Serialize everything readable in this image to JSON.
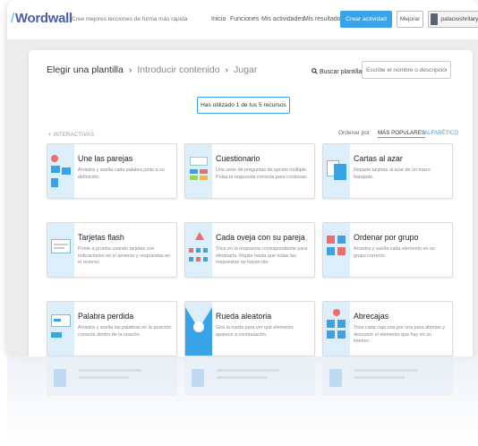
{
  "header": {
    "logo": "Wordwall",
    "tagline": "Cree mejores lecciones de forma más rápida",
    "nav": [
      "Inicio",
      "Funciones",
      "Mis actividades",
      "Mis resultados"
    ],
    "create_button": "Crear actividad",
    "upgrade_button": "Mejorar",
    "username": "palacioshrilary"
  },
  "breadcrumb": {
    "step1": "Elegir una plantilla",
    "step2": "Introducir contenido",
    "step3": "Jugar",
    "separator": "›"
  },
  "search": {
    "label": "Buscar plantillas",
    "placeholder": "Escribe el nombre o descripción..."
  },
  "usage_text": "Has utilizado 1 de tus 5 recursos",
  "section_label": "+ INTERACTIVAS",
  "sort": {
    "label": "Ordenar por:",
    "options": [
      "MÁS POPULARES",
      "ALFABÉTICO"
    ],
    "selected": "MÁS POPULARES"
  },
  "templates": [
    {
      "title": "Une las parejas",
      "desc": "Arrastra y suelta cada palabra junto a su definición."
    },
    {
      "title": "Cuestionario",
      "desc": "Una serie de preguntas de opción múltiple. Pulsa la respuesta correcta para continuar."
    },
    {
      "title": "Cartas al azar",
      "desc": "Reparte tarjetas al azar de un mazo barajado."
    },
    {
      "title": "Tarjetas flash",
      "desc": "Ponte a prueba usando tarjetas con indicaciones en el anverso y respuestas en el reverso."
    },
    {
      "title": "Cada oveja con su pareja",
      "desc": "Toca en la respuesta correspondiente para eliminarla. Repite hasta que todas las respuestas se hayan ido."
    },
    {
      "title": "Ordenar por grupo",
      "desc": "Arrastra y suelta cada elemento en su grupo correcto."
    },
    {
      "title": "Palabra perdida",
      "desc": "Arrastra y suelta las palabras en la posición correcta dentro de la oración."
    },
    {
      "title": "Rueda aleatoria",
      "desc": "Gira la rueda para ver qué elemento aparece a continuación."
    },
    {
      "title": "Abrecajas",
      "desc": "Toca cada caja una por una para abrirlas y descubrir el elemento que hay en su interior."
    }
  ],
  "colors": {
    "accent": "#39a3e8",
    "logo": "#4a5ea8",
    "thumb_bg": "#dbeef9",
    "page_bg": "#ececec"
  }
}
